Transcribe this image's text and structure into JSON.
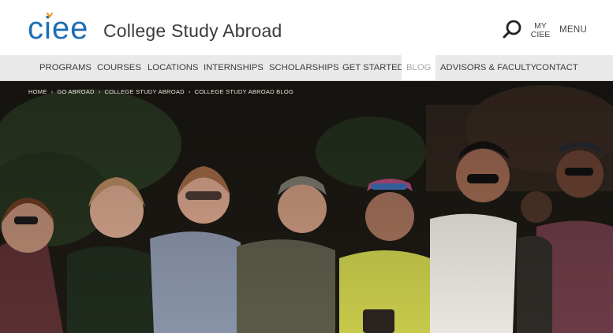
{
  "brand": {
    "logo_text": "ciee",
    "title": "College Study Abroad",
    "logo_color": "#1f6fb2",
    "logo_accent": "#f39b25"
  },
  "header": {
    "search_icon": "search-icon",
    "my_ciee_line1": "MY",
    "my_ciee_line2": "CIEE",
    "menu_label": "MENU"
  },
  "nav": {
    "items": [
      {
        "label": "PROGRAMS"
      },
      {
        "label": "COURSES"
      },
      {
        "label": "LOCATIONS"
      },
      {
        "label": "INTERNSHIPS"
      },
      {
        "label": "SCHOLARSHIPS"
      },
      {
        "label": "GET STARTED"
      },
      {
        "label": "BLOG",
        "active": true
      },
      {
        "label": "ADVISORS & FACULTY"
      },
      {
        "label": "CONTACT"
      }
    ]
  },
  "breadcrumb": {
    "items": [
      "HOME",
      "GO ABROAD",
      "COLLEGE STUDY ABROAD",
      "COLLEGE STUDY ABROAD BLOG"
    ],
    "separator": "›"
  },
  "hero": {
    "image": "group-photo-students-outdoors"
  }
}
